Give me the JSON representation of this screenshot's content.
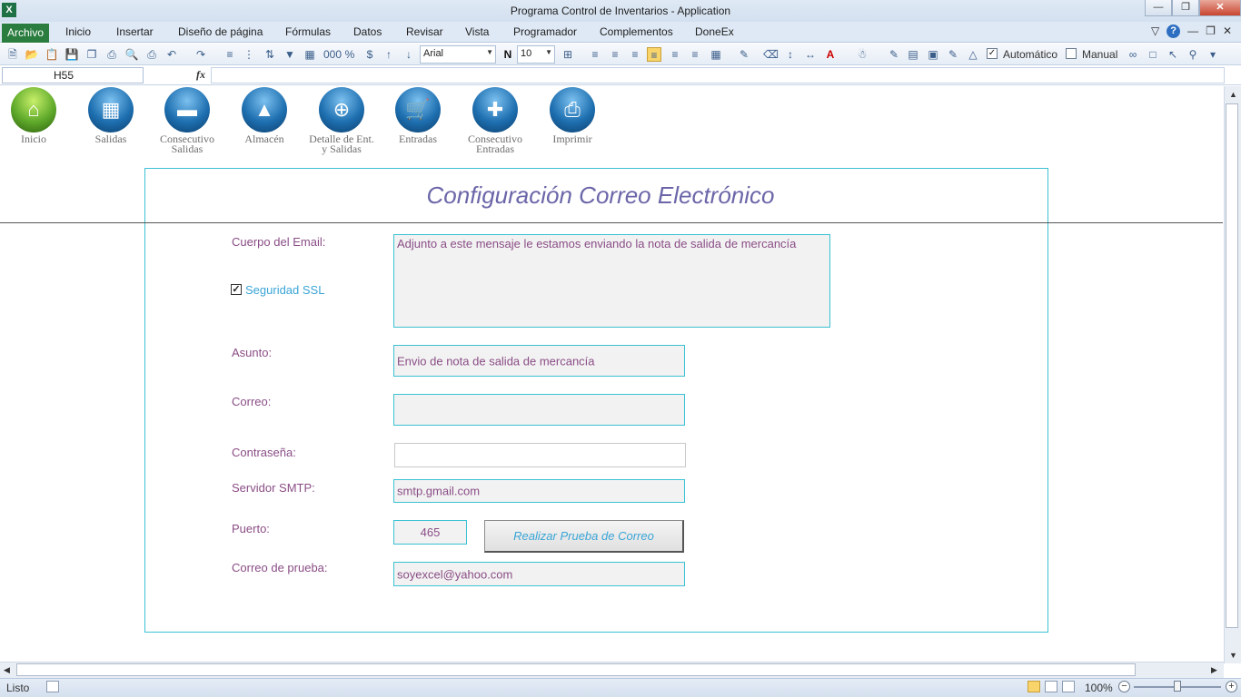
{
  "window": {
    "title": "Programa Control de Inventarios  -  Application",
    "app_logo_icon": "excel-logo-icon",
    "app_logo_text": "X"
  },
  "ribbon": {
    "file_tab": "Archivo",
    "tabs": [
      "Inicio",
      "Insertar",
      "Diseño de página",
      "Fórmulas",
      "Datos",
      "Revisar",
      "Vista",
      "Programador",
      "Complementos",
      "DoneEx"
    ]
  },
  "toolbar": {
    "font_name": "Arial",
    "font_size": "10",
    "bold_label": "N",
    "thousands_label": "000",
    "percent_label": "%",
    "currency_label": "$",
    "calc_auto_label": "Automático",
    "calc_manual_label": "Manual",
    "calc_auto_checked": true,
    "calc_manual_checked": false
  },
  "formula_bar": {
    "cell_ref": "H55",
    "fx_label": "fx",
    "formula": ""
  },
  "nav": [
    {
      "label": "Inicio",
      "icon": "home-icon"
    },
    {
      "label": "Salidas",
      "icon": "calculator-icon"
    },
    {
      "label": "Consecutivo Salidas",
      "icon": "document-minus-icon"
    },
    {
      "label": "Almacén",
      "icon": "warehouse-icon"
    },
    {
      "label": "Detalle de Ent. y Salidas",
      "icon": "target-icon"
    },
    {
      "label": "Entradas",
      "icon": "cart-icon"
    },
    {
      "label": "Consecutivo Entradas",
      "icon": "document-plus-icon"
    },
    {
      "label": "Imprimir",
      "icon": "printer-icon"
    }
  ],
  "form": {
    "title": "Configuración Correo Electrónico",
    "body_label": "Cuerpo del Email:",
    "body_value": "Adjunto a este mensaje le estamos enviando la nota de salida de mercancía",
    "ssl_label": "Seguridad SSL",
    "ssl_checked": true,
    "subject_label": "Asunto:",
    "subject_value": "Envio de nota de salida de mercancía",
    "email_label": "Correo:",
    "email_value": "",
    "password_label": "Contraseña:",
    "password_value": "",
    "smtp_label": "Servidor SMTP:",
    "smtp_value": "smtp.gmail.com",
    "port_label": "Puerto:",
    "port_value": "465",
    "test_button": "Realizar Prueba de Correo",
    "test_email_label": "Correo de prueba:",
    "test_email_value": "soyexcel@yahoo.com"
  },
  "status": {
    "ready": "Listo",
    "zoom": "100%"
  },
  "colors": {
    "accent_border": "#3bc1d3",
    "label_color": "#8a4d86",
    "title_color": "#6b66a8",
    "link_color": "#3aa5d6"
  }
}
